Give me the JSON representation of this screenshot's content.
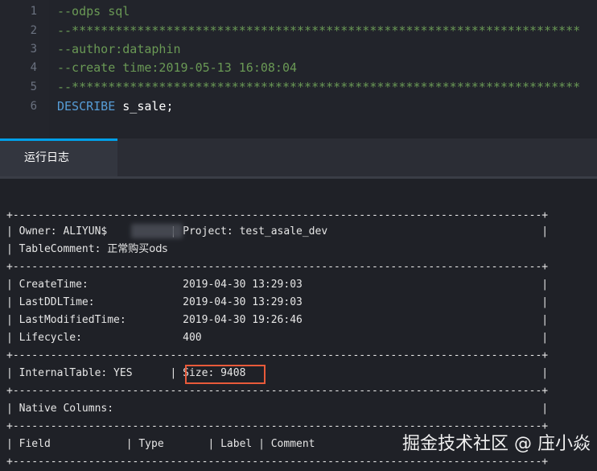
{
  "editor": {
    "line_numbers": [
      "1",
      "2",
      "3",
      "4",
      "5",
      "6"
    ],
    "lines": [
      {
        "text": "--odps sql",
        "type": "comment"
      },
      {
        "text": "--**********************************************************************",
        "type": "comment"
      },
      {
        "text": "--author:dataphin",
        "type": "comment"
      },
      {
        "text": "--create time:2019-05-13 16:08:04",
        "type": "comment"
      },
      {
        "text": "--**********************************************************************",
        "type": "comment"
      },
      {
        "keyword": "DESCRIBE",
        "rest": " s_sale;",
        "type": "code"
      }
    ]
  },
  "tabs": {
    "log_label": "运行日志"
  },
  "log": {
    "border1": "+------------------------------------------------------------------------------------+",
    "owner_line": "| Owner: ALIYUN$          | Project: test_asale_dev                                  |",
    "comment_prefix": "| TableComment: ",
    "comment_value": "正常购买ods",
    "comment_suffix": "                                                                     |",
    "border2": "+------------------------------------------------------------------------------------+",
    "create_time": "| CreateTime:               2019-04-30 13:29:03                                      |",
    "ddl_time": "| LastDDLTime:              2019-04-30 13:29:03                                      |",
    "modified_time": "| LastModifiedTime:         2019-04-30 19:26:46                                      |",
    "lifecycle": "| Lifecycle:                400                                                      |",
    "border3": "+------------------------------------------------------------------------------------+",
    "internal_line": "| InternalTable: YES      | Size: 9408                                               |",
    "border4": "+------------------------------------------------------------------------------------+",
    "native_columns": "| Native Columns:                                                                    |",
    "border5": "+------------------------------------------------------------------------------------+",
    "columns_header": "| Field            | Type       | Label | Comment                                     |",
    "border6": "+------------------------------------------------------------------------------------+"
  },
  "watermark": "掘金技术社区 @ 庄小焱",
  "colors": {
    "background": "#1f2127",
    "comment": "#6a9955",
    "keyword": "#569cd6",
    "tab_accent": "#00a0e9",
    "highlight": "#e85a3a"
  }
}
